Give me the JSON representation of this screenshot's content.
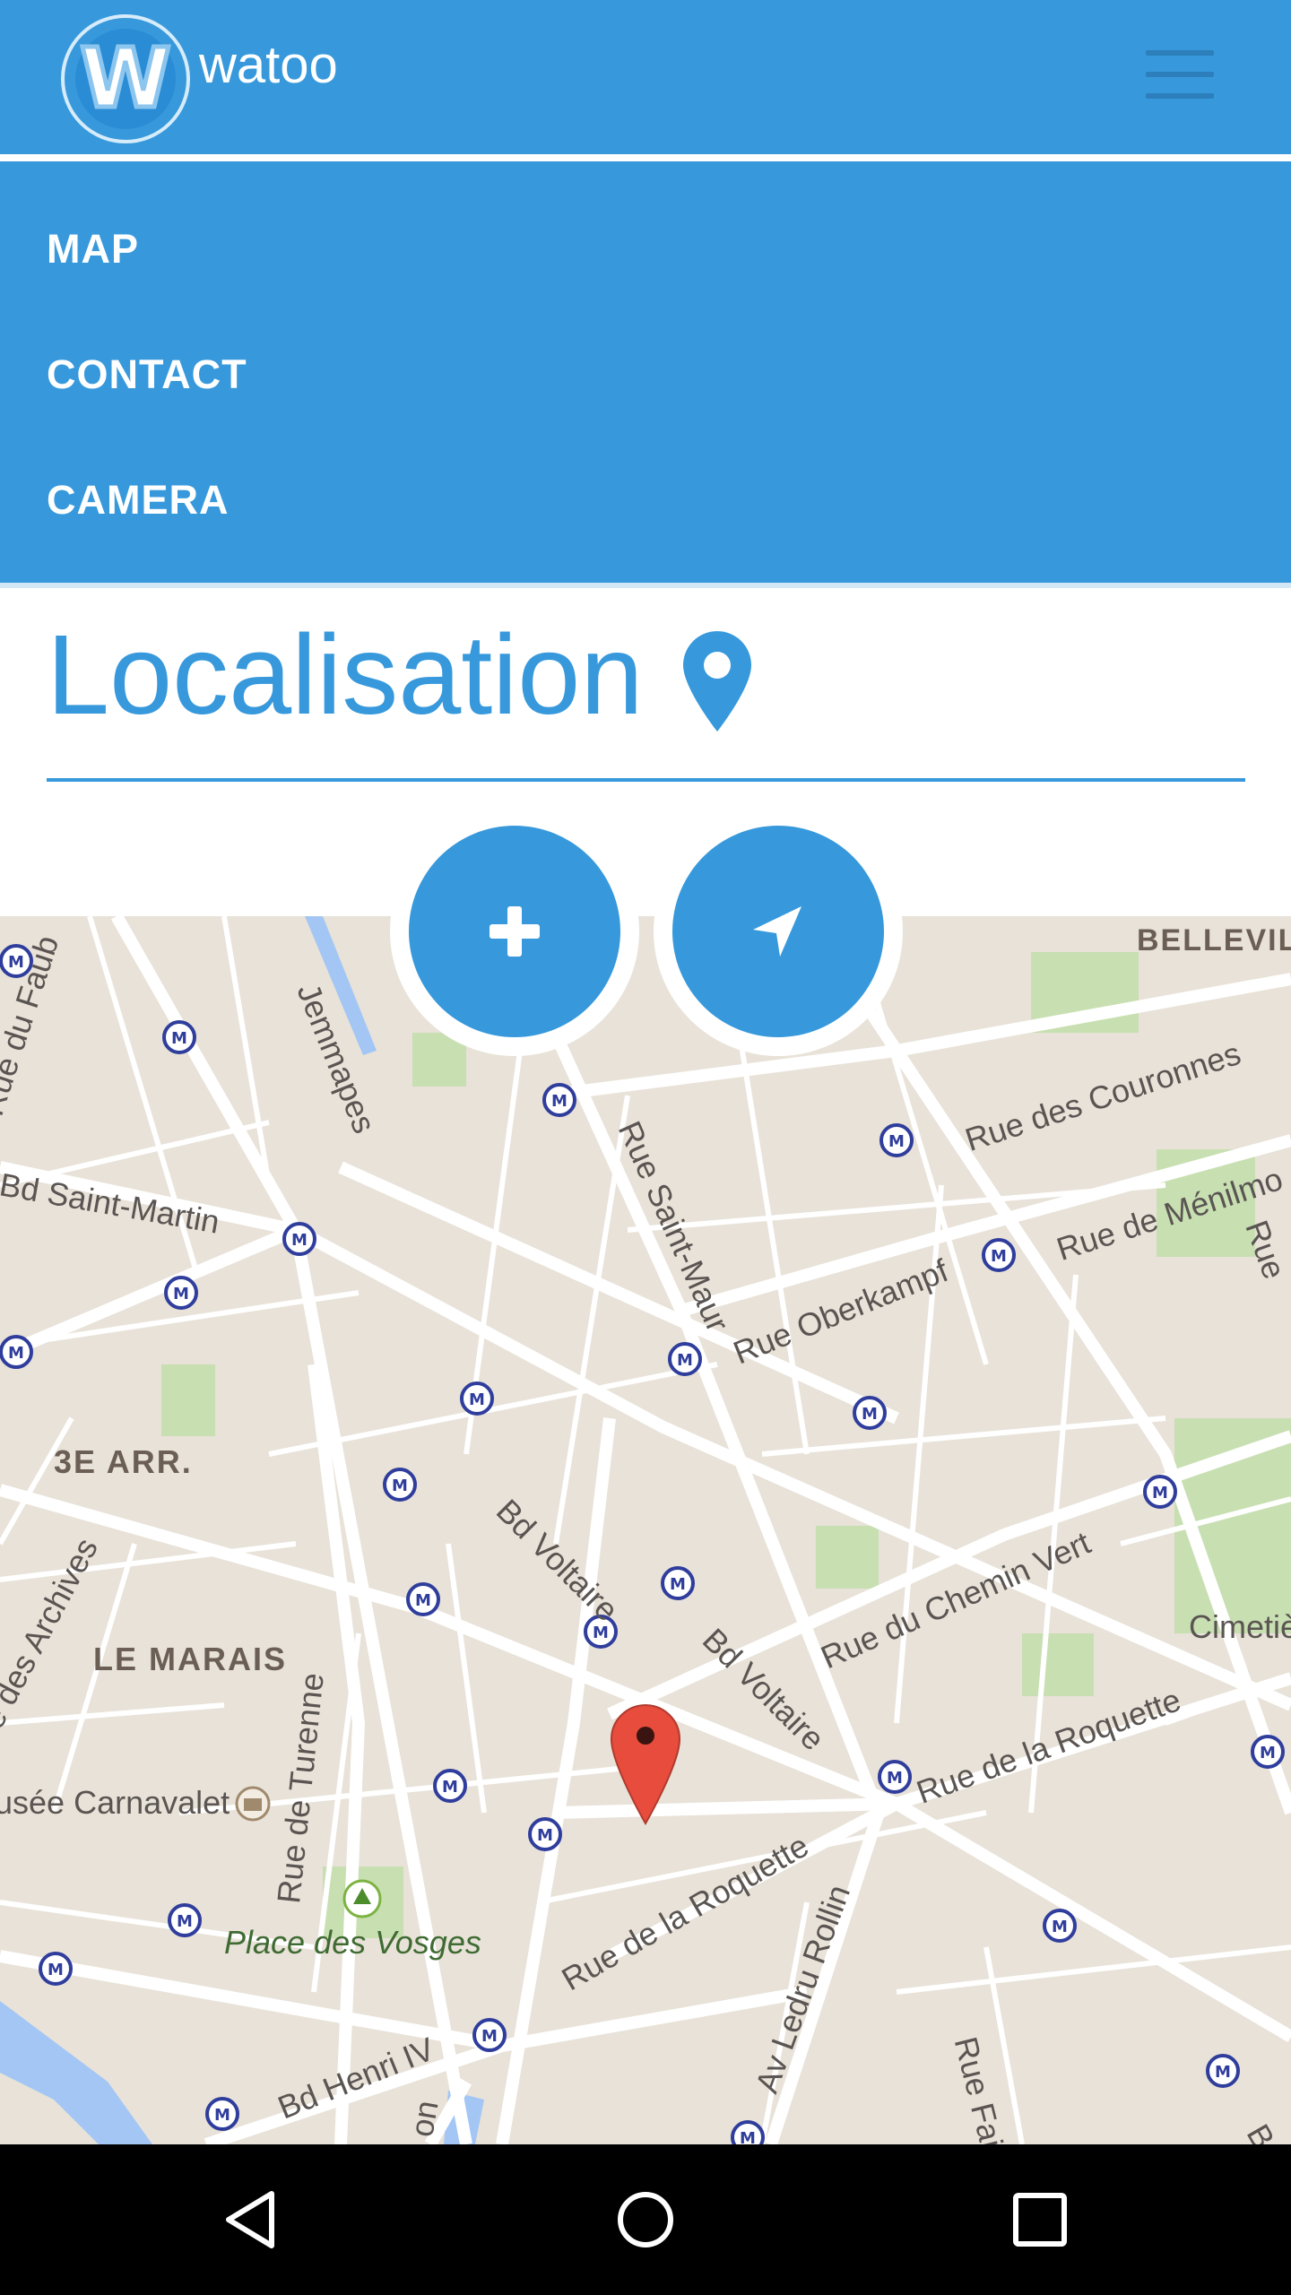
{
  "header": {
    "logo_letter": "W",
    "brand": "watoo"
  },
  "nav": {
    "items": [
      {
        "label": "MAP"
      },
      {
        "label": "CONTACT"
      },
      {
        "label": "CAMERA"
      }
    ]
  },
  "page": {
    "title": "Localisation"
  },
  "map": {
    "labels": [
      "BELLEVIL",
      "Rue des Couronnes",
      "Rue de Ménilmo",
      "Rue",
      "Jemmapes",
      "Rue du Faub",
      "Bd Saint-Martin",
      "Rue Saint-Maur",
      "Rue Oberkampf",
      "3E ARR.",
      "Bd Voltaire",
      "Bd Voltaire",
      "Rue du Chemin Vert",
      "Cimetiè",
      "ue des Archives",
      "LE MARAIS",
      "Rue de Turenne",
      "Rue de la Roquette",
      "usée Carnavalet",
      "Rue de la Roquette",
      "Av Ledru Rollin",
      "Rue Faidhe",
      "Place des Vosges",
      "Bd Henri IV",
      "Bo",
      "on"
    ]
  },
  "actions": {
    "add_icon": "plus-icon",
    "locate_icon": "navigation-arrow-icon"
  },
  "system_nav": {
    "back": "back-triangle-icon",
    "home": "home-circle-icon",
    "recents": "recents-square-icon"
  },
  "colors": {
    "primary": "#3799dc",
    "map_background": "#e8e2d8",
    "marker": "#e74c3c"
  }
}
